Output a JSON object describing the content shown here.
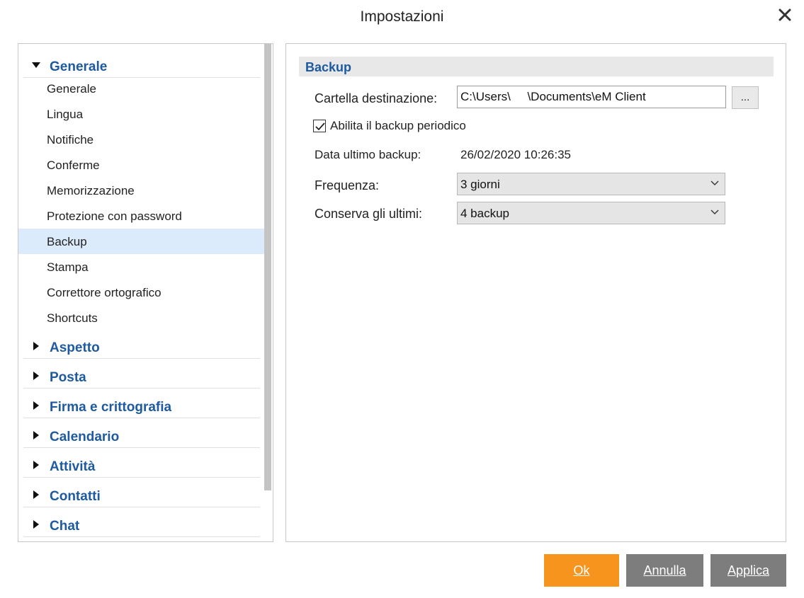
{
  "window": {
    "title": "Impostazioni"
  },
  "sidebar": {
    "groups": [
      {
        "label": "Generale",
        "expanded": true
      },
      {
        "label": "Aspetto",
        "expanded": false
      },
      {
        "label": "Posta",
        "expanded": false
      },
      {
        "label": "Firma e crittografia",
        "expanded": false
      },
      {
        "label": "Calendario",
        "expanded": false
      },
      {
        "label": "Attività",
        "expanded": false
      },
      {
        "label": "Contatti",
        "expanded": false
      },
      {
        "label": "Chat",
        "expanded": false
      }
    ],
    "general_items": [
      {
        "label": "Generale"
      },
      {
        "label": "Lingua"
      },
      {
        "label": "Notifiche"
      },
      {
        "label": "Conferme"
      },
      {
        "label": "Memorizzazione"
      },
      {
        "label": "Protezione con password"
      },
      {
        "label": "Backup",
        "selected": true
      },
      {
        "label": "Stampa"
      },
      {
        "label": "Correttore ortografico"
      },
      {
        "label": "Shortcuts"
      }
    ]
  },
  "backup": {
    "section_title": "Backup",
    "folder_label": "Cartella destinazione:",
    "folder_value": "C:\\Users\\     \\Documents\\eM Client",
    "browse_label": "...",
    "periodic_label": "Abilita il backup periodico",
    "periodic_checked": true,
    "last_backup_label": "Data ultimo backup:",
    "last_backup_value": "26/02/2020 10:26:35",
    "frequency_label": "Frequenza:",
    "frequency_value": "3 giorni",
    "keep_label": "Conserva gli ultimi:",
    "keep_value": "4 backup"
  },
  "footer": {
    "ok_label": "Ok",
    "cancel_label": "Annulla",
    "apply_label": "Applica"
  },
  "colors": {
    "accent": "#f7941d",
    "link_blue": "#1d5aa0",
    "selected_bg": "#dcebfb",
    "button_gray": "#7d7d7d"
  }
}
